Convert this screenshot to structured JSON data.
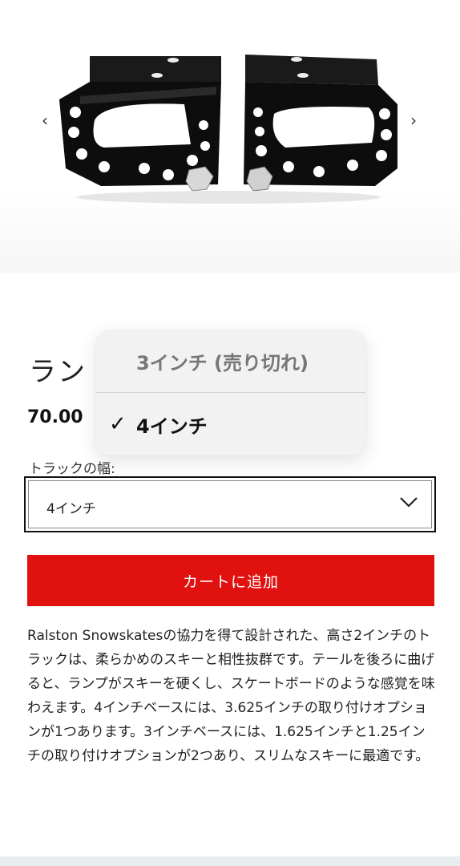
{
  "gallery": {
    "prev_icon": "chevron-left-icon",
    "next_icon": "chevron-right-icon",
    "prev_glyph": "‹",
    "next_glyph": "›"
  },
  "product": {
    "title_partial": "ラン",
    "price_partial": "70.00"
  },
  "track": {
    "label": "トラックの幅:",
    "selected_value": "4インチ"
  },
  "dropdown": {
    "options": [
      {
        "label": "3インチ (売り切れ)",
        "selected": false,
        "disabled": true
      },
      {
        "label": "4インチ",
        "selected": true,
        "disabled": false
      }
    ],
    "check_glyph": "✓"
  },
  "cart": {
    "button_label": "カートに追加",
    "color": "#e0110f"
  },
  "description": "Ralston Snowskatesの協力を得て設計された、高さ2インチのトラックは、柔らかめのスキーと相性抜群です。テールを後ろに曲げると、ランプがスキーを硬くし、スケートボードのような感覚を味わえます。4インチベースには、3.625インチの取り付けオプションが1つあります。3インチベースには、1.625インチと1.25インチの取り付けオプションが2つあり、スリムなスキーに最適です。"
}
